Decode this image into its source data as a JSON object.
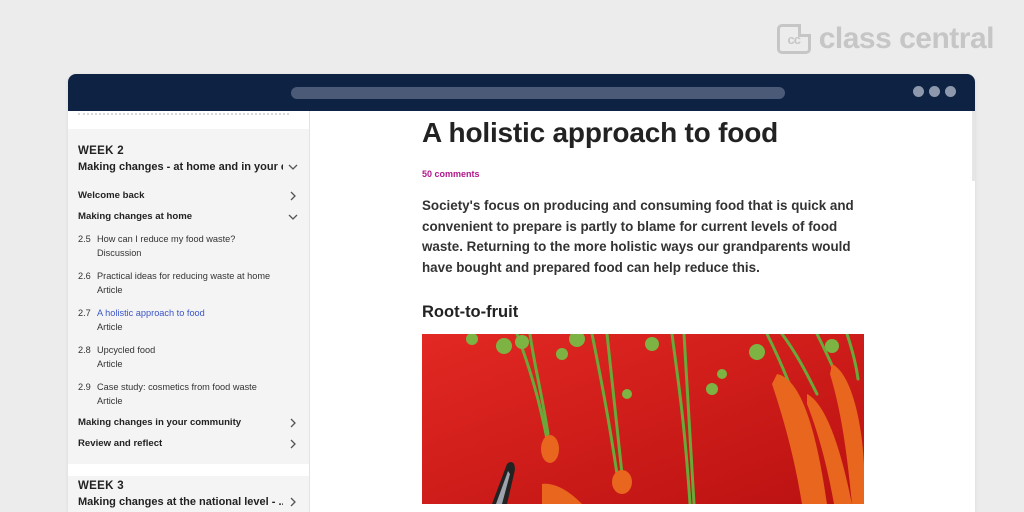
{
  "brand": {
    "name": "class central",
    "icon": "cc"
  },
  "sidebar": {
    "week2": {
      "label": "WEEK 2",
      "title": "Making changes - at home and in your c...",
      "sections": [
        {
          "label": "Welcome back",
          "state": "collapsed"
        },
        {
          "label": "Making changes at home",
          "state": "expanded"
        }
      ],
      "steps": [
        {
          "num": "2.5",
          "title": "How can I reduce my food waste?",
          "type": "Discussion"
        },
        {
          "num": "2.6",
          "title": "Practical ideas for reducing waste at home",
          "type": "Article"
        },
        {
          "num": "2.7",
          "title": "A holistic approach to food",
          "type": "Article"
        },
        {
          "num": "2.8",
          "title": "Upcycled food",
          "type": "Article"
        },
        {
          "num": "2.9",
          "title": "Case study: cosmetics from food waste",
          "type": "Article"
        }
      ],
      "after_sections": [
        {
          "label": "Making changes in your community"
        },
        {
          "label": "Review and reflect"
        }
      ]
    },
    "week3": {
      "label": "WEEK 3",
      "title": "Making changes at the national level - ..."
    }
  },
  "article": {
    "title": "A holistic approach to food",
    "comments": "50 comments",
    "lead": "Society's focus on producing and consuming food that is quick and convenient to prepare is partly to blame for current levels of food waste. Returning to the more holistic ways our grandparents would have bought and prepared food can help reduce this.",
    "subheading": "Root-to-fruit",
    "image_desc": "carrots-on-red-cutting-board"
  },
  "colors": {
    "titlebar": "#0e2244",
    "active_link": "#3b55c7",
    "comments": "#b0178b",
    "board_red": "#d31616",
    "carrot_orange": "#e8661e"
  }
}
